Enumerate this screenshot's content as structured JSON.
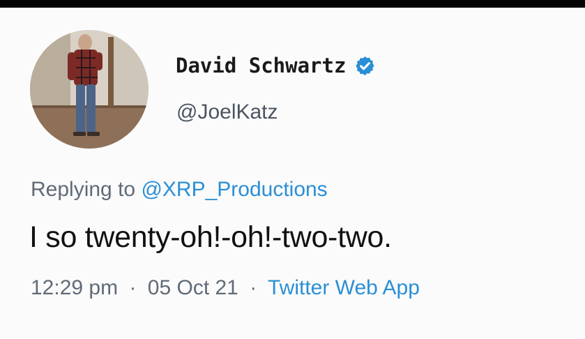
{
  "tweet": {
    "author": {
      "display_name": "David Schwartz",
      "handle": "@JoelKatz",
      "verified": true
    },
    "reply": {
      "prefix": "Replying to",
      "to": "@XRP_Productions"
    },
    "text": "I so twenty-oh!-oh!-two-two.",
    "meta": {
      "time": "12:29 pm",
      "date": "05 Oct 21",
      "separator": "·",
      "source": "Twitter Web App"
    }
  },
  "colors": {
    "link": "#2a8fd6",
    "verified_badge": "#2a8fd6",
    "text": "#111111",
    "secondary": "#5f6b77"
  },
  "icons": {
    "verified": "verified-badge-icon"
  }
}
